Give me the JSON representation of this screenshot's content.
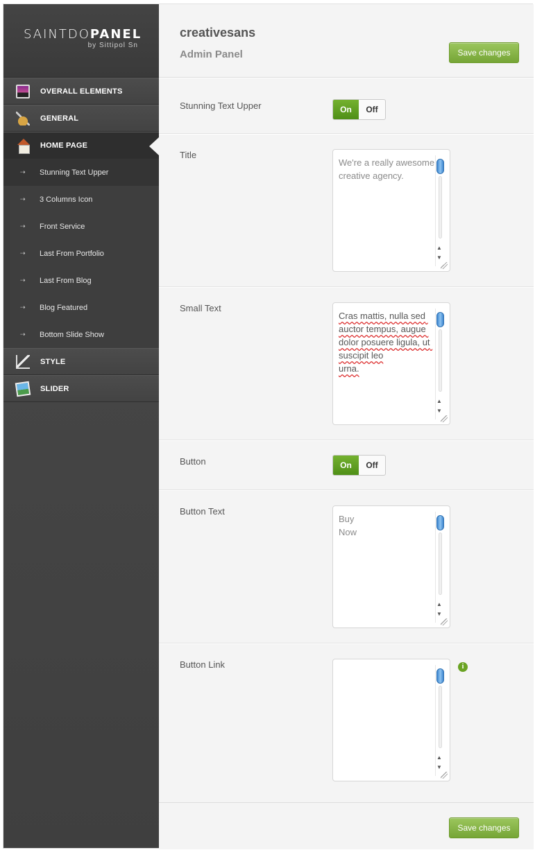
{
  "logo": {
    "brand_light": "SAINTDO",
    "brand_bold": "PANEL",
    "byline": "by Sittipol Sn"
  },
  "sidebar": {
    "items": [
      {
        "label": "OVERALL ELEMENTS",
        "icon": "monitor-icon"
      },
      {
        "label": "GENERAL",
        "icon": "tools-icon"
      },
      {
        "label": "HOME PAGE",
        "icon": "home-icon",
        "active": true
      },
      {
        "label": "STYLE",
        "icon": "set-square-icon"
      },
      {
        "label": "SLIDER",
        "icon": "picture-icon"
      }
    ],
    "subitems": [
      {
        "label": "Stunning Text Upper",
        "current": true
      },
      {
        "label": "3 Columns Icon"
      },
      {
        "label": "Front Service"
      },
      {
        "label": "Last From Portfolio"
      },
      {
        "label": "Last From Blog"
      },
      {
        "label": "Blog Featured"
      },
      {
        "label": "Bottom Slide Show"
      }
    ],
    "subitem_arrow": "⇢"
  },
  "header": {
    "site_name": "creativesans",
    "panel_name": "Admin Panel",
    "save_label": "Save changes"
  },
  "form": {
    "stunning": {
      "label": "Stunning Text Upper",
      "on": "On",
      "off": "Off",
      "state": "on"
    },
    "title": {
      "label": "Title",
      "value": "We're a really awesome creative agency."
    },
    "small_text": {
      "label": "Small Text",
      "value": "Cras mattis, nulla sed auctor tempus, augue dolor posuere ligula, ut suscipit leo\nurna."
    },
    "button": {
      "label": "Button",
      "on": "On",
      "off": "Off",
      "state": "on"
    },
    "button_text": {
      "label": "Button Text",
      "value": "Buy\nNow"
    },
    "button_link": {
      "label": "Button Link",
      "value": "",
      "info_icon": "i"
    }
  },
  "footer": {
    "save_label": "Save changes"
  },
  "colors": {
    "accent_green": "#76a536",
    "sidebar_bg": "#444444",
    "main_bg": "#f4f4f4",
    "scroll_blue": "#3d86d0"
  }
}
